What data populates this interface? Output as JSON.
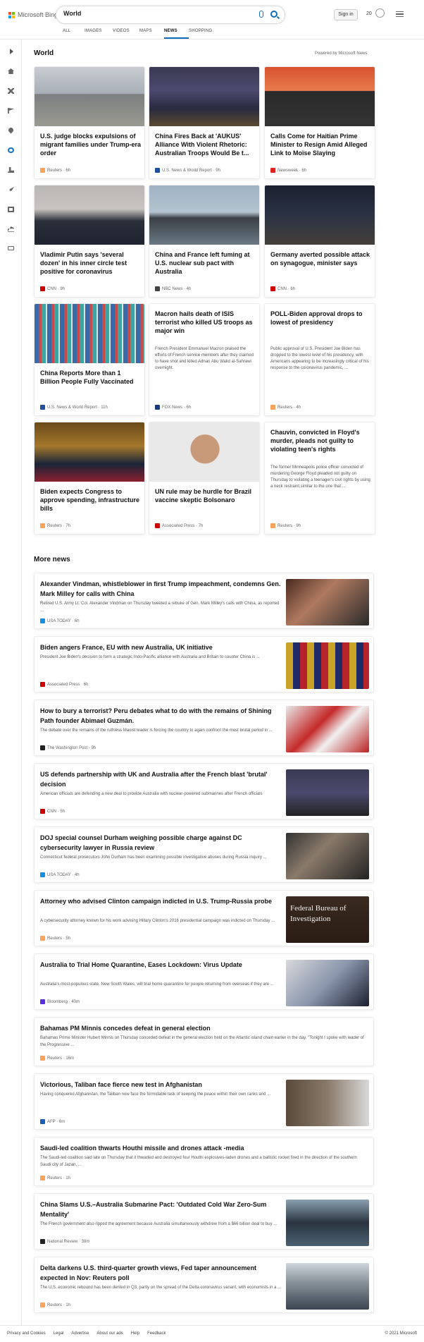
{
  "header": {
    "brand": "Microsoft Bing",
    "query": "World",
    "signin_label": "Sign in",
    "points": "20",
    "tabs": [
      "ALL",
      "IMAGES",
      "VIDEOS",
      "MAPS",
      "NEWS",
      "SHOPPING"
    ],
    "active_tab": "NEWS"
  },
  "section": {
    "title": "World",
    "powered": "Powered by Microsoft News"
  },
  "cards": [
    {
      "title": "U.S. judge blocks expulsions of migrant families under Trump-era order",
      "source": "Reuters · 6h",
      "src_color": "#f7a35c",
      "img": "linear-gradient(180deg,#c9cdd3 0%,#a8aeb6 45%,#7b7f80 46%,#9a9a90 100%)"
    },
    {
      "title": "China Fires Back at 'AUKUS' Alliance With Violent Rhetoric: Australian Troops Would Be t...",
      "source": "U.S. News & World Report · 9h",
      "src_color": "#1f4e9c",
      "img": "linear-gradient(180deg,#3b3a52 0%,#4b4a6e 40%,#2a2a40 70%,#5a4a30 100%)"
    },
    {
      "title": "Calls Come for Haitian Prime Minister to Resign Amid Alleged Link to Moïse Slaying",
      "source": "Newsweek · 6h",
      "src_color": "#d22",
      "img": "linear-gradient(180deg,#d8532f 0%,#e77a4d 40%,#2a2a2a 41%,#333 100%)"
    },
    {
      "title": "Vladimir Putin says 'several dozen' in his inner circle test positive for coronavirus",
      "source": "CNN · 9h",
      "src_color": "#cc0000",
      "img": "linear-gradient(180deg,#b9b7b4 0%,#c7c4c0 40%,#2b2f3a 60%,#1f2330 100%)"
    },
    {
      "title": "China and France left fuming at U.S. nuclear sub pact with Australia",
      "source": "NBC News · 4h",
      "src_color": "#444",
      "img": "linear-gradient(180deg,#9fb3c4 0%,#b3c3cf 45%,#3a3f44 55%,#6a7a85 100%)"
    },
    {
      "title": "Germany averted possible attack on synagogue, minister says",
      "source": "CNN · 6h",
      "src_color": "#cc0000",
      "img": "linear-gradient(180deg,#1b2030 0%,#2b3344 50%,#44403a 100%)"
    },
    {
      "title": "China Reports More than 1 Billion People Fully Vaccinated",
      "source": "U.S. News & World Report · 11h",
      "src_color": "#1f4e9c",
      "img": "repeating-linear-gradient(90deg,#3a6aa8 0 6px,#c74a4a 6px 10px,#3fa3a0 10px 16px,#e0e0e0 16px 18px)"
    },
    {
      "title": "Macron hails death of ISIS terrorist who killed US troops as major win",
      "desc": "French President Emmanuel Macron praised the efforts of French service members after they claimed to have shot and killed Adnan Abu Walid al-Sahrawi overnight.",
      "source": "FOX News · 6h",
      "src_color": "#1a3a7a"
    },
    {
      "title": "POLL-Biden approval drops to lowest of presidency",
      "desc": "Public approval of U.S. President Joe Biden has dropped to the lowest level of his presidency, with Americans appearing to be increasingly critical of his response to the coronavirus pandemic, ...",
      "source": "Reuters · 4h",
      "src_color": "#f7a35c"
    },
    {
      "title": "Biden expects Congress to approve spending, infrastructure bills",
      "source": "Reuters · 7h",
      "src_color": "#f7a35c",
      "img": "linear-gradient(180deg,#6a4a1a 0%,#a4782c 40%,#1a2438 70%,#8a2030 100%)"
    },
    {
      "title": "UN rule may be hurdle for Brazil vaccine skeptic Bolsonaro",
      "source": "Associated Press · 7h",
      "src_color": "#cc0000",
      "img": "radial-gradient(circle at 50% 45%,#c89a7a 0 22%,#e9e9e9 23% 100%)"
    },
    {
      "title": "Chauvin, convicted in Floyd's murder, pleads not guilty to violating teen's rights",
      "desc": "The former Minneapolis police officer convicted of murdering George Floyd pleaded not guilty on Thursday to violating a teenager's civil rights by using a neck restraint similar to the one that ...",
      "source": "Reuters · 9h",
      "src_color": "#f7a35c"
    }
  ],
  "more_news": {
    "title": "More news",
    "items": [
      {
        "title": "Alexander Vindman, whistleblower in first Trump impeachment, condemns Gen. Mark Milley for calls with China",
        "snippet": "Retired U.S. Army Lt. Col. Alexander Vindman on Thursday tweeted a rebuke of Gen. Mark Milley's calls with China, as reported ...",
        "source": "USA TODAY · 6h",
        "src_color": "#1a8fe0",
        "img": "linear-gradient(135deg,#4a2a20 0%,#b07a60 40%,#2a2a2a 100%)"
      },
      {
        "title": "Biden angers France, EU with new Australia, UK initiative",
        "snippet": "President Joe Biden's decision to form a strategic Indo-Pacific alliance with Australia and Britain to counter China is ...",
        "source": "Associated Press · 6h",
        "src_color": "#cc0000",
        "img": "repeating-linear-gradient(90deg,#c9a227 0 10px,#1d2a66 10px 20px,#b5242c 20px 30px)"
      },
      {
        "title": "How to bury a terrorist? Peru debates what to do with the remains of Shining Path founder Abimael Guzmán.",
        "snippet": "The debate over the remains of the ruthless Maoist leader is forcing the country to again confront the most brutal period in ...",
        "source": "The Washington Post · 9h",
        "src_color": "#222",
        "img": "linear-gradient(135deg,#e8e8e8 0%,#c52a2a 40%,#f0f0f0 60%,#b22 100%)"
      },
      {
        "title": "US defends partnership with UK and Australia after the French blast 'brutal' decision",
        "snippet": "American officials are defending a new deal to provide Australia with nuclear-powered submarines after French officials",
        "source": "CNN · 5h",
        "src_color": "#cc0000",
        "img": "linear-gradient(180deg,#3b3a52 0%,#4b4a6e 50%,#222 100%)"
      },
      {
        "title": "DOJ special counsel Durham weighing possible charge against DC cybersecurity lawyer in Russia review",
        "snippet": "Connecticut federal prosecutors John Durham has been examining possible investigative abuses during Russia inquiry ...",
        "source": "USA TODAY · 4h",
        "src_color": "#1a8fe0",
        "img": "linear-gradient(135deg,#333 0%,#8a7a6a 40%,#222 100%)"
      },
      {
        "title": "Attorney who advised Clinton campaign indicted in U.S. Trump-Russia probe",
        "snippet": "A cybersecurity attorney known for his work advising Hillary Clinton's 2016 presidential campaign was indicted on Thursday ...",
        "source": "Reuters · 5h",
        "src_color": "#f7a35c",
        "img_text": "Federal Bureau of Investigation",
        "img": "linear-gradient(180deg,#3a2a20 0%,#2a1c14 100%)"
      },
      {
        "title": "Australia to Trial Home Quarantine, Eases Lockdown: Virus Update",
        "snippet": "Australia's most-populous state, New South Wales, will trial home quarantine for people returning from overseas if they are ...",
        "source": "Bloomberg · 40m",
        "src_color": "#5a2ee0",
        "img": "linear-gradient(135deg,#d8d8dc 0%,#8a96ac 50%,#1c2030 100%)"
      },
      {
        "title": "Bahamas PM Minnis concedes defeat in general election",
        "snippet": "Bahamas Prime Minister Hubert Minnis on Thursday conceded defeat in the general election held on the Atlantic island chain earlier in the day. \"Tonight I spoke with leader of the Progressive ...",
        "source": "Reuters · 16m",
        "src_color": "#f7a35c"
      },
      {
        "title": "Victorious, Taliban face fierce new test in Afghanistan",
        "snippet": "Having conquered Afghanistan, the Taliban now face the formidable task of keeping the peace within their own ranks and ...",
        "source": "AFP · 6m",
        "src_color": "#1a5fb4",
        "img": "linear-gradient(90deg,#5a4a3a 0%,#8a7a6a 50%,#d8d8d8 100%)"
      },
      {
        "title": "Saudi-led coalition thwarts Houthi missile and drones attack -media",
        "snippet": "The Saudi-led coalition said late on Thursday that it thwarted and destroyed four Houthi explosives-laden drones and a ballistic rocket fired in the direction of the southern Saudi city of Jazan, ...",
        "source": "Reuters · 1h",
        "src_color": "#f7a35c"
      },
      {
        "title": "China Slams U.S.–Australia Submarine Pact: 'Outdated Cold War Zero-Sum Mentality'",
        "snippet": "The French government also ripped the agreement because Australia simultaneously withdrew from a $66 billion deal to buy ...",
        "source": "National Review · 38m",
        "src_color": "#222",
        "img": "linear-gradient(180deg,#8aa0b0 0%,#2a3440 50%,#4a6070 100%)"
      },
      {
        "title": "Delta darkens U.S. third-quarter growth views, Fed taper announcement expected in Nov: Reuters poll",
        "snippet": "The U.S. economic rebound has been dented in Q3, partly on the spread of the Delta coronavirus variant, with economists in a ...",
        "source": "Reuters · 1h",
        "src_color": "#f7a35c",
        "img": "linear-gradient(180deg,#cfd6dc 0%,#8a949c 40%,#3a4450 100%)"
      }
    ]
  },
  "footer": {
    "links": [
      "Privacy and Cookies",
      "Legal",
      "Advertise",
      "About our ads",
      "Help",
      "Feedback"
    ],
    "copyright": "© 2021 Microsoft"
  }
}
